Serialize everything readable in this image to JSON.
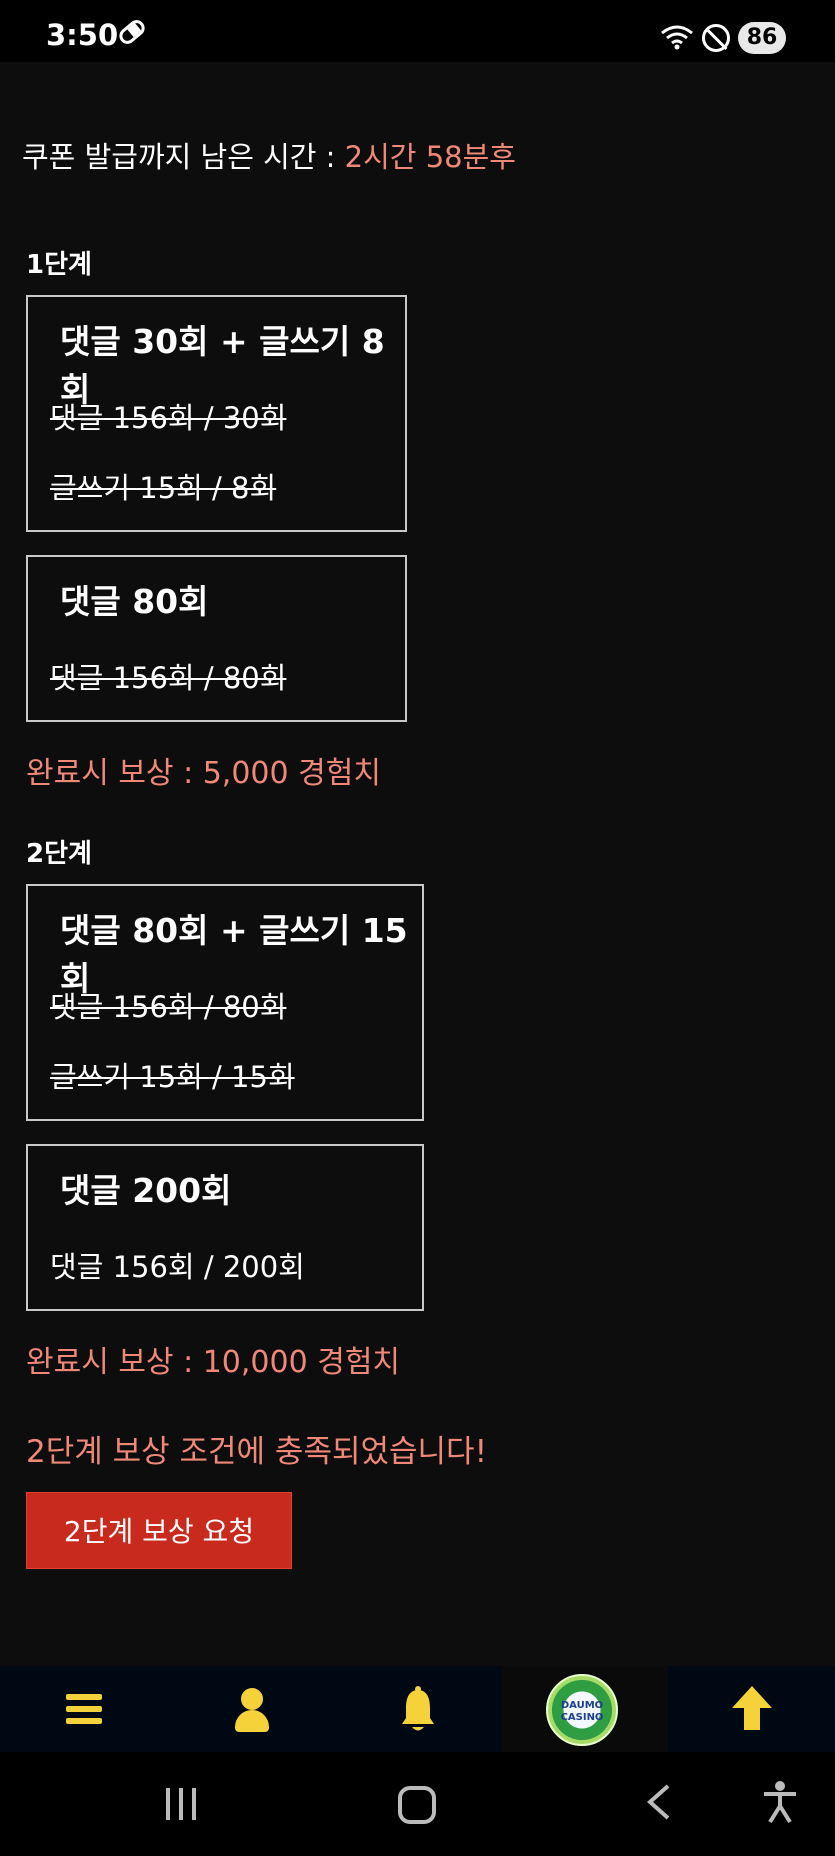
{
  "status_bar": {
    "time": "3:50",
    "battery": "86",
    "icons": [
      "pill-icon",
      "wifi-icon",
      "do-not-disturb-icon",
      "battery-icon"
    ]
  },
  "timer": {
    "label": "쿠폰 발급까지 남은 시간 : ",
    "value": "2시간 58분후"
  },
  "stage1": {
    "title": "1단계",
    "card1": {
      "title": "댓글 30회 + 글쓰기 8회",
      "line1": "댓글 156회 / 30회",
      "line2": "글쓰기 15회 / 8회"
    },
    "card2": {
      "title": "댓글 80회",
      "line1": "댓글 156회 / 80회"
    },
    "reward": "완료시 보상 : 5,000 경험치"
  },
  "stage2": {
    "title": "2단계",
    "card1": {
      "title": "댓글 80회 + 글쓰기 15회",
      "line1": "댓글 156회 / 80회",
      "line2": "글쓰기 15회 / 15회"
    },
    "card2": {
      "title": "댓글 200회",
      "line1": "댓글 156회 / 200회"
    },
    "reward": "완료시 보상 : 10,000 경험치"
  },
  "notice": "2단계 보상 조건에 충족되었습니다!",
  "request_button": "2단계 보상 요청",
  "bottom_nav": {
    "logo_line1": "DAUMO",
    "logo_line2": "CASINO",
    "icons": [
      "menu-icon",
      "user-icon",
      "bell-icon",
      "casino-logo",
      "arrow-up-icon"
    ]
  },
  "colors": {
    "accent": "#f08878",
    "icon_yellow": "#f5d23a",
    "button_red": "#c82a1e"
  }
}
